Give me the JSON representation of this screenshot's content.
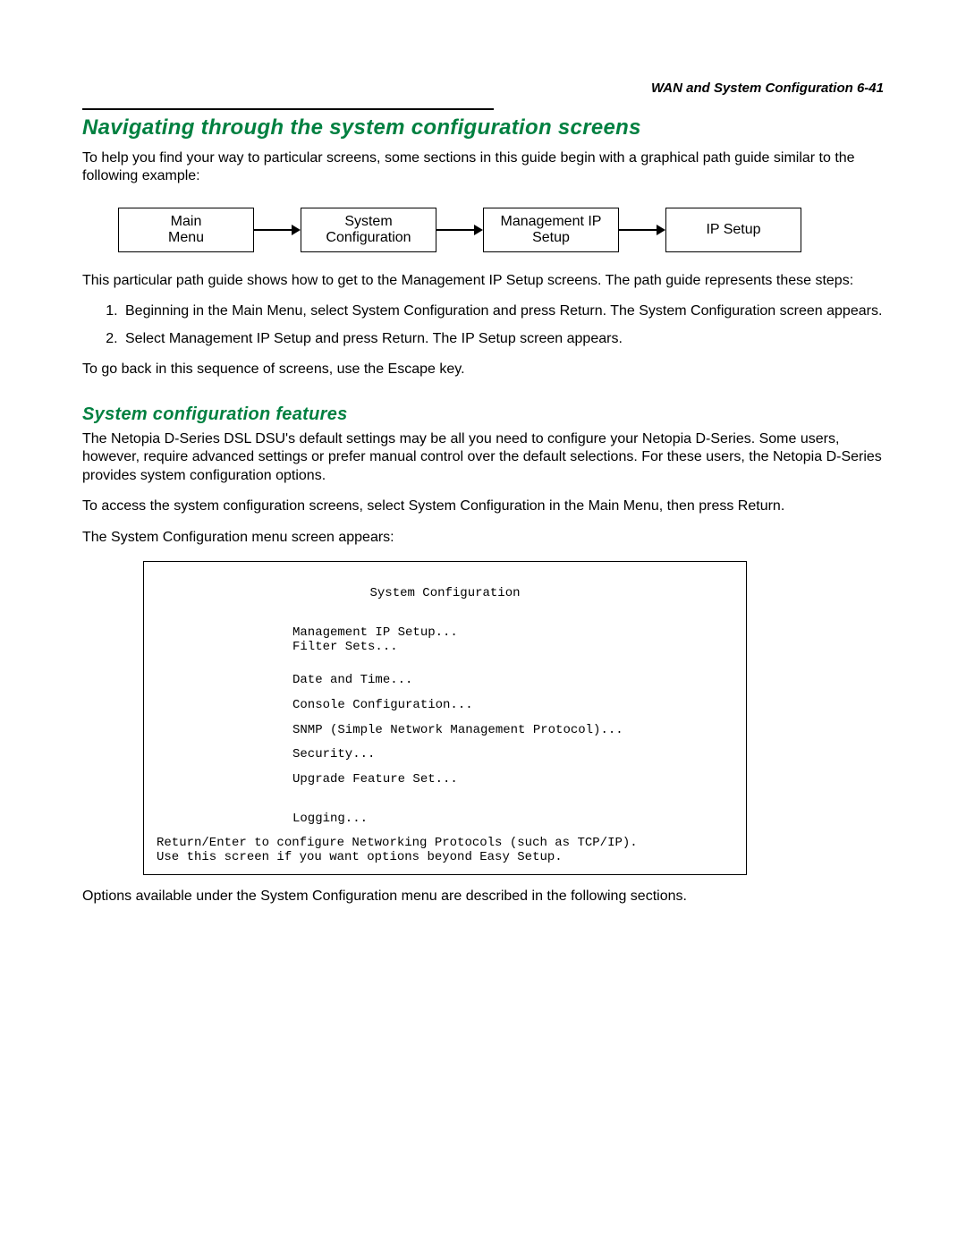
{
  "header": {
    "running_head": "WAN and System Configuration   6-41"
  },
  "section": {
    "title": "Navigating through the system configuration screens",
    "intro": "To help you find your way to particular screens, some sections in this guide begin with a graphical path guide similar to the following example:",
    "path_boxes": [
      "Main\nMenu",
      "System\nConfiguration",
      "Management IP\nSetup",
      "IP Setup"
    ],
    "after_path": "This particular path guide shows how to get to the Management IP Setup screens. The path guide represents these steps:",
    "steps": [
      "Beginning in the Main Menu, select System Configuration and press Return. The System Configuration screen appears.",
      "Select Management IP Setup and press Return. The IP Setup screen appears."
    ],
    "escape_note": "To go back in this sequence of screens, use the Escape key."
  },
  "subsection": {
    "title": "System configuration features",
    "p1": "The Netopia D-Series DSL DSU's default settings may be all you need to configure your Netopia D-Series. Some users, however, require advanced settings or prefer manual control over the default selections. For these users, the Netopia D-Series provides system configuration options.",
    "p2": "To access the system configuration screens, select System Configuration in the Main Menu, then press Return.",
    "p3": "The System Configuration menu screen appears:",
    "term": {
      "title": "System Configuration",
      "items": [
        "Management IP Setup...",
        "Filter Sets...",
        "Date and Time...",
        "Console Configuration...",
        "SNMP (Simple Network Management Protocol)...",
        "Security...",
        "Upgrade Feature Set...",
        "Logging..."
      ],
      "footer1": "Return/Enter to configure Networking Protocols (such as TCP/IP).",
      "footer2": "Use this screen if you want options beyond Easy Setup."
    },
    "after_term": "Options available under the System Configuration menu are described in the following sections."
  }
}
